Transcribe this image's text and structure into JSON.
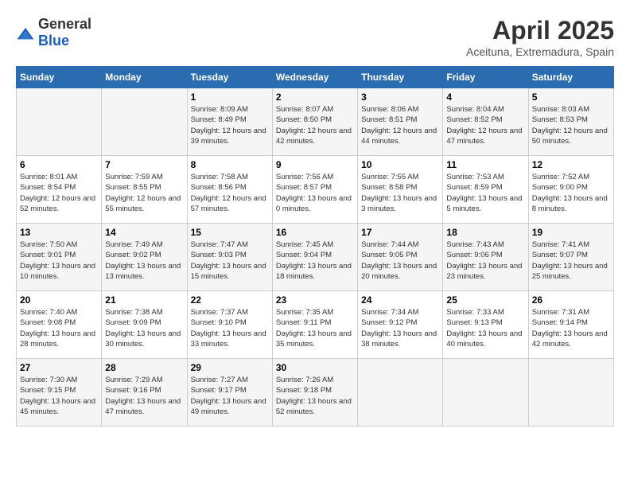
{
  "header": {
    "logo_general": "General",
    "logo_blue": "Blue",
    "month_title": "April 2025",
    "location": "Aceituna, Extremadura, Spain"
  },
  "weekdays": [
    "Sunday",
    "Monday",
    "Tuesday",
    "Wednesday",
    "Thursday",
    "Friday",
    "Saturday"
  ],
  "weeks": [
    [
      {
        "day": "",
        "info": ""
      },
      {
        "day": "",
        "info": ""
      },
      {
        "day": "1",
        "info": "Sunrise: 8:09 AM\nSunset: 8:49 PM\nDaylight: 12 hours and 39 minutes."
      },
      {
        "day": "2",
        "info": "Sunrise: 8:07 AM\nSunset: 8:50 PM\nDaylight: 12 hours and 42 minutes."
      },
      {
        "day": "3",
        "info": "Sunrise: 8:06 AM\nSunset: 8:51 PM\nDaylight: 12 hours and 44 minutes."
      },
      {
        "day": "4",
        "info": "Sunrise: 8:04 AM\nSunset: 8:52 PM\nDaylight: 12 hours and 47 minutes."
      },
      {
        "day": "5",
        "info": "Sunrise: 8:03 AM\nSunset: 8:53 PM\nDaylight: 12 hours and 50 minutes."
      }
    ],
    [
      {
        "day": "6",
        "info": "Sunrise: 8:01 AM\nSunset: 8:54 PM\nDaylight: 12 hours and 52 minutes."
      },
      {
        "day": "7",
        "info": "Sunrise: 7:59 AM\nSunset: 8:55 PM\nDaylight: 12 hours and 55 minutes."
      },
      {
        "day": "8",
        "info": "Sunrise: 7:58 AM\nSunset: 8:56 PM\nDaylight: 12 hours and 57 minutes."
      },
      {
        "day": "9",
        "info": "Sunrise: 7:56 AM\nSunset: 8:57 PM\nDaylight: 13 hours and 0 minutes."
      },
      {
        "day": "10",
        "info": "Sunrise: 7:55 AM\nSunset: 8:58 PM\nDaylight: 13 hours and 3 minutes."
      },
      {
        "day": "11",
        "info": "Sunrise: 7:53 AM\nSunset: 8:59 PM\nDaylight: 13 hours and 5 minutes."
      },
      {
        "day": "12",
        "info": "Sunrise: 7:52 AM\nSunset: 9:00 PM\nDaylight: 13 hours and 8 minutes."
      }
    ],
    [
      {
        "day": "13",
        "info": "Sunrise: 7:50 AM\nSunset: 9:01 PM\nDaylight: 13 hours and 10 minutes."
      },
      {
        "day": "14",
        "info": "Sunrise: 7:49 AM\nSunset: 9:02 PM\nDaylight: 13 hours and 13 minutes."
      },
      {
        "day": "15",
        "info": "Sunrise: 7:47 AM\nSunset: 9:03 PM\nDaylight: 13 hours and 15 minutes."
      },
      {
        "day": "16",
        "info": "Sunrise: 7:45 AM\nSunset: 9:04 PM\nDaylight: 13 hours and 18 minutes."
      },
      {
        "day": "17",
        "info": "Sunrise: 7:44 AM\nSunset: 9:05 PM\nDaylight: 13 hours and 20 minutes."
      },
      {
        "day": "18",
        "info": "Sunrise: 7:43 AM\nSunset: 9:06 PM\nDaylight: 13 hours and 23 minutes."
      },
      {
        "day": "19",
        "info": "Sunrise: 7:41 AM\nSunset: 9:07 PM\nDaylight: 13 hours and 25 minutes."
      }
    ],
    [
      {
        "day": "20",
        "info": "Sunrise: 7:40 AM\nSunset: 9:08 PM\nDaylight: 13 hours and 28 minutes."
      },
      {
        "day": "21",
        "info": "Sunrise: 7:38 AM\nSunset: 9:09 PM\nDaylight: 13 hours and 30 minutes."
      },
      {
        "day": "22",
        "info": "Sunrise: 7:37 AM\nSunset: 9:10 PM\nDaylight: 13 hours and 33 minutes."
      },
      {
        "day": "23",
        "info": "Sunrise: 7:35 AM\nSunset: 9:11 PM\nDaylight: 13 hours and 35 minutes."
      },
      {
        "day": "24",
        "info": "Sunrise: 7:34 AM\nSunset: 9:12 PM\nDaylight: 13 hours and 38 minutes."
      },
      {
        "day": "25",
        "info": "Sunrise: 7:33 AM\nSunset: 9:13 PM\nDaylight: 13 hours and 40 minutes."
      },
      {
        "day": "26",
        "info": "Sunrise: 7:31 AM\nSunset: 9:14 PM\nDaylight: 13 hours and 42 minutes."
      }
    ],
    [
      {
        "day": "27",
        "info": "Sunrise: 7:30 AM\nSunset: 9:15 PM\nDaylight: 13 hours and 45 minutes."
      },
      {
        "day": "28",
        "info": "Sunrise: 7:29 AM\nSunset: 9:16 PM\nDaylight: 13 hours and 47 minutes."
      },
      {
        "day": "29",
        "info": "Sunrise: 7:27 AM\nSunset: 9:17 PM\nDaylight: 13 hours and 49 minutes."
      },
      {
        "day": "30",
        "info": "Sunrise: 7:26 AM\nSunset: 9:18 PM\nDaylight: 13 hours and 52 minutes."
      },
      {
        "day": "",
        "info": ""
      },
      {
        "day": "",
        "info": ""
      },
      {
        "day": "",
        "info": ""
      }
    ]
  ]
}
